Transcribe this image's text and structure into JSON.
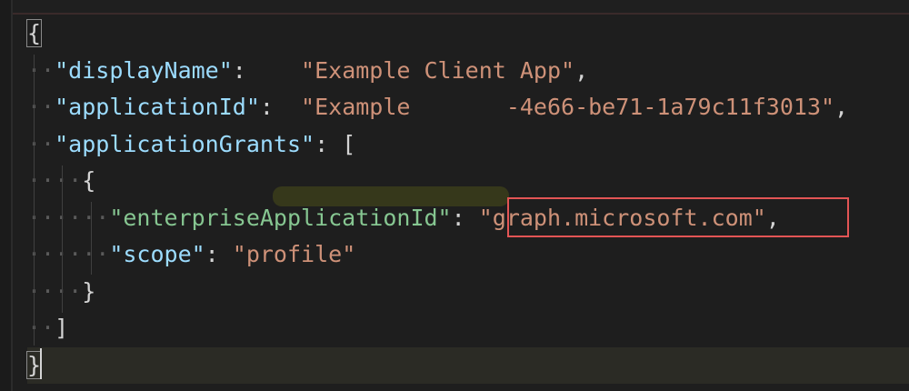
{
  "editor": {
    "language": "json",
    "lines": [
      {
        "indent": "",
        "tokens": [
          {
            "cls": "brace",
            "t": "{"
          }
        ]
      },
      {
        "indent": "··",
        "tokens": [
          {
            "cls": "key",
            "t": "\"displayName\""
          },
          {
            "cls": "punct",
            "t": ":    "
          },
          {
            "cls": "str",
            "t": "\"Example Client App\""
          },
          {
            "cls": "punct",
            "t": ","
          }
        ]
      },
      {
        "indent": "··",
        "tokens": [
          {
            "cls": "key",
            "t": "\"applicationId\""
          },
          {
            "cls": "punct",
            "t": ":  "
          },
          {
            "cls": "str",
            "t": "\"Example       -4e66-be71-1a79c11f3013\""
          },
          {
            "cls": "punct",
            "t": ","
          }
        ]
      },
      {
        "indent": "··",
        "tokens": [
          {
            "cls": "key",
            "t": "\"applicationGrants\""
          },
          {
            "cls": "punct",
            "t": ": "
          },
          {
            "cls": "brace",
            "t": "["
          }
        ]
      },
      {
        "indent": "····",
        "tokens": [
          {
            "cls": "brace",
            "t": "{"
          }
        ]
      },
      {
        "indent": "······",
        "tokens": [
          {
            "cls": "key-green",
            "t": "\"enterpriseApplicationId\""
          },
          {
            "cls": "punct",
            "t": ": "
          },
          {
            "cls": "str",
            "t": "\"graph.microsoft.com\""
          },
          {
            "cls": "punct",
            "t": ","
          }
        ]
      },
      {
        "indent": "······",
        "tokens": [
          {
            "cls": "key",
            "t": "\"scope\""
          },
          {
            "cls": "punct",
            "t": ": "
          },
          {
            "cls": "str",
            "t": "\"profile\""
          }
        ]
      },
      {
        "indent": "····",
        "tokens": [
          {
            "cls": "brace",
            "t": "}"
          }
        ]
      },
      {
        "indent": "··",
        "tokens": [
          {
            "cls": "brace",
            "t": "]"
          }
        ]
      },
      {
        "indent": "",
        "tokens": [
          {
            "cls": "brace",
            "t": "}"
          }
        ]
      }
    ],
    "highlighted_value": "\"graph.microsoft.com\"",
    "colors": {
      "background": "#1e1e1e",
      "key": "#9cdcfe",
      "string": "#ce9178",
      "highlight_border": "#e35555"
    }
  }
}
